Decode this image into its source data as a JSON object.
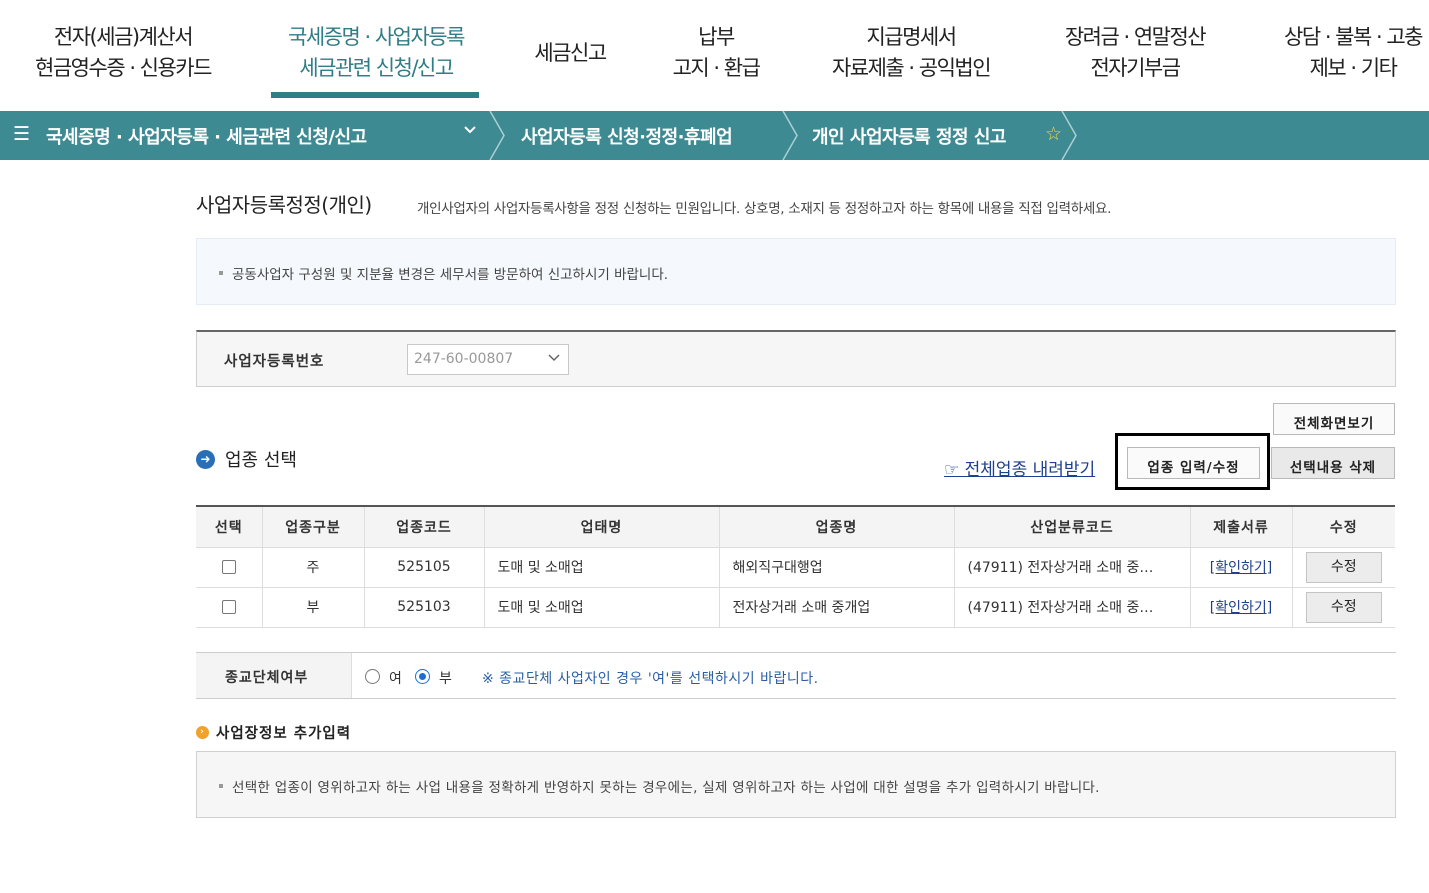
{
  "topnav": {
    "items": [
      {
        "line1": "전자(세금)계산서",
        "line2": "현금영수증 · 신용카드"
      },
      {
        "line1": "국세증명 · 사업자등록",
        "line2": "세금관련 신청/신고"
      },
      {
        "line1": "세금신고",
        "line2": ""
      },
      {
        "line1": "납부",
        "line2": "고지 · 환급"
      },
      {
        "line1": "지급명세서",
        "line2": "자료제출 · 공익법인"
      },
      {
        "line1": "장려금 · 연말정산",
        "line2": "전자기부금"
      },
      {
        "line1": "상담 · 불복 · 고충",
        "line2": "제보 · 기타"
      }
    ],
    "accent_color": "#2f7d86"
  },
  "breadcrumb": {
    "menu_icon": "☰",
    "level1": "국세증명 · 사업자등록 · 세금관련 신청/신고",
    "level2": "사업자등록 신청·정정·휴폐업",
    "level3": "개인 사업자등록 정정 신고",
    "bar_color": "#3e8a93"
  },
  "page": {
    "title": "사업자등록정정(개인)",
    "description": "개인사업자의 사업자등록사항을 정정 신청하는 민원입니다. 상호명, 소재지 등 정정하고자 하는 항목에 내용을 직접 입력하세요.",
    "notice": "공동사업자 구성원 및 지분율 변경은 세무서를 방문하여 신고하시기 바랍니다."
  },
  "registration": {
    "label": "사업자등록번호",
    "selected_value": "247-60-00807"
  },
  "business": {
    "section_title": "업종 선택",
    "download_link": "☞ 전체업종 내려받기",
    "buttons": {
      "fullscreen": "전체화면보기",
      "input_edit": "업종 입력/수정",
      "delete_selected": "선택내용 삭제"
    },
    "columns": [
      "선택",
      "업종구분",
      "업종코드",
      "업태명",
      "업종명",
      "산업분류코드",
      "제출서류",
      "수정"
    ],
    "rows": [
      {
        "type": "주",
        "code": "525105",
        "business_type": "도매 및 소매업",
        "item_name": "해외직구대행업",
        "industry_code": "(47911) 전자상거래 소매 중…",
        "docs": "[확인하기]",
        "edit": "수정"
      },
      {
        "type": "부",
        "code": "525103",
        "business_type": "도매 및 소매업",
        "item_name": "전자상거래 소매 중개업",
        "industry_code": "(47911) 전자상거래 소매 중…",
        "docs": "[확인하기]",
        "edit": "수정"
      }
    ]
  },
  "religious": {
    "label": "종교단체여부",
    "option_yes": "여",
    "option_no": "부",
    "selected": "부",
    "note": "※ 종교단체 사업자인 경우 '여'를 선택하시기 바랍니다."
  },
  "additional": {
    "title": "사업장정보 추가입력",
    "notice": "선택한 업종이 영위하고자 하는 사업 내용을 정확하게 반영하지 못하는 경우에는, 실제 영위하고자 하는 사업에 대한 설명을 추가 입력하시기 바랍니다."
  }
}
